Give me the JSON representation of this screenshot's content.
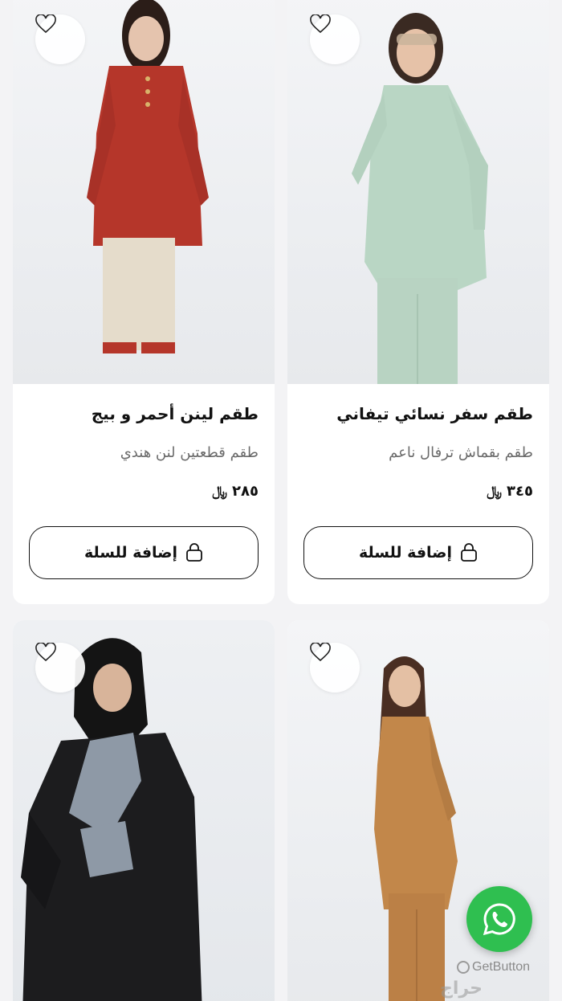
{
  "products": [
    {
      "title": "طقم سفر نسائي تيفاني",
      "subtitle": "طقم بقماش ترفال ناعم",
      "price": "٣٤٥",
      "currency": "﷼",
      "cart_label": "إضافة للسلة",
      "colors": {
        "top": "#b9d6c4",
        "bottom": "#b8d3c2",
        "hair": "#3a2a22"
      }
    },
    {
      "title": "طقم لينن أحمر و بيج",
      "subtitle": "طقم قطعتين لنن هندي",
      "price": "٢٨٥",
      "currency": "﷼",
      "cart_label": "إضافة للسلة",
      "colors": {
        "top": "#b5362a",
        "bottom": "#e5dccb",
        "hair": "#2b1d18"
      }
    },
    {
      "title": "",
      "colors": {
        "top": "#c2874a",
        "bottom": "#bb8046",
        "hair": "#4a2e22"
      }
    },
    {
      "title": "",
      "colors": {
        "top": "#1c1c1e",
        "bottom": "#1c1c1e",
        "accent": "#8e99a6"
      }
    }
  ],
  "floating": {
    "whatsapp_color": "#2fbf50",
    "getbutton_label": "GetButton",
    "watermark": "حراج"
  }
}
